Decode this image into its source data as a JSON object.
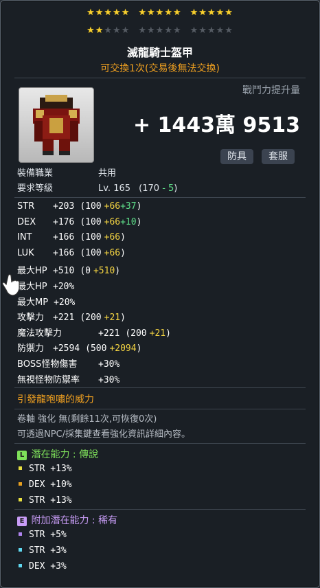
{
  "stars": {
    "rows": [
      [
        "on",
        "on",
        "on",
        "on",
        "on",
        " ",
        "on",
        "on",
        "on",
        "on",
        "on",
        " ",
        "on",
        "on",
        "on",
        "on",
        "on"
      ],
      [
        "on",
        "on",
        "off",
        "off",
        "off",
        " ",
        "off",
        "off",
        "off",
        "off",
        "off",
        " ",
        "off",
        "off",
        "off",
        "off",
        "off"
      ]
    ]
  },
  "item": {
    "name": "滅龍騎士盔甲",
    "tradable": "可交換1次(交易後無法交換)",
    "combat_power_label": "戰鬥力提升量",
    "combat_power_value": "+ 1443萬 9513",
    "tags": [
      "防具",
      "套服"
    ],
    "job_label": "裝備職業",
    "job_value": "共用",
    "req_label": "要求等級",
    "req_value": "Lv. 165",
    "req_paren_open": "(170",
    "req_minus": "- 5",
    "req_paren_close": ")"
  },
  "stats": [
    {
      "name": "STR",
      "total": "+203",
      "base": "(100",
      "add": "+66",
      "extra": "+37",
      "close": ")"
    },
    {
      "name": "DEX",
      "total": "+176",
      "base": "(100",
      "add": "+66",
      "extra": "+10",
      "close": ")"
    },
    {
      "name": "INT",
      "total": "+166",
      "base": "(100",
      "add": "+66",
      "extra": "",
      "close": ")"
    },
    {
      "name": "LUK",
      "total": "+166",
      "base": "(100",
      "add": "+66",
      "extra": "",
      "close": ")"
    },
    {
      "name": "最大HP",
      "total": "+510",
      "base": "(0",
      "add": "+510",
      "extra": "",
      "close": ")"
    },
    {
      "name": "最大HP",
      "total": "+20%",
      "base": "",
      "add": "",
      "extra": "",
      "close": ""
    },
    {
      "name": "最大MP",
      "total": "+20%",
      "base": "",
      "add": "",
      "extra": "",
      "close": ""
    },
    {
      "name": "攻擊力",
      "total": "+221",
      "base": "(200",
      "add": "+21",
      "extra": "",
      "close": ")"
    },
    {
      "name": "魔法攻擊力",
      "total": "+221",
      "base": "(200",
      "add": "+21",
      "extra": "",
      "close": ")"
    },
    {
      "name": "防禦力",
      "total": "+2594",
      "base": "(500",
      "add": "+2094",
      "extra": "",
      "close": ")"
    },
    {
      "name": "BOSS怪物傷害",
      "total": "+30%",
      "base": "",
      "add": "",
      "extra": "",
      "close": ""
    },
    {
      "name": "無視怪物防禦率",
      "total": "+30%",
      "base": "",
      "add": "",
      "extra": "",
      "close": ""
    }
  ],
  "soul": "引發龍咆嘯的威力",
  "scroll_line1": "卷軸 強化 無(剩餘11次,可恢復0次)",
  "scroll_line2": "可透過NPC/採集鍵查看強化資訊詳細內容。",
  "potential": {
    "badge": "L",
    "title": "潛在能力 : 傳說",
    "lines": [
      "STR +13%",
      "DEX +10%",
      "STR +13%"
    ],
    "dot_colors": [
      "#e8e040",
      "#e8a020",
      "#e8e040"
    ],
    "color": "#7ee05a"
  },
  "bonus_potential": {
    "badge": "E",
    "title": "附加潛在能力 : 稀有",
    "lines": [
      "STR +5%",
      "STR +3%",
      "DEX +3%"
    ],
    "dot_colors": [
      "#b084f0",
      "#60d8f0",
      "#60d8f0"
    ],
    "color": "#c89cf6"
  },
  "colors": {
    "gold": "#f8d030",
    "orange": "#f0a020",
    "yellow": "#f4d442",
    "green": "#5fe08a"
  }
}
